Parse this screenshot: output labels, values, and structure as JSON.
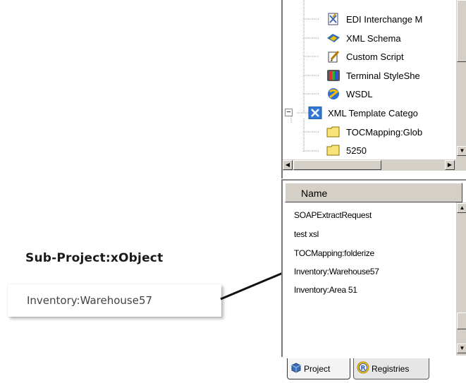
{
  "annotation": {
    "title": "Sub-Project:xObject",
    "callout": "Inventory:Warehouse57"
  },
  "tree": {
    "items": [
      {
        "label": "EDI Interchange M",
        "icon": "edi-interchange-icon"
      },
      {
        "label": "XML Schema",
        "icon": "xml-schema-icon"
      },
      {
        "label": "Custom Script",
        "icon": "custom-script-icon"
      },
      {
        "label": "Terminal StyleShe",
        "icon": "terminal-stylesheet-icon"
      },
      {
        "label": "WSDL",
        "icon": "wsdl-icon"
      },
      {
        "label": "XML Template Catego",
        "icon": "xml-template-category-icon"
      },
      {
        "label": "TOCMapping:Glob",
        "icon": "folder-icon"
      },
      {
        "label": "5250",
        "icon": "folder-icon"
      }
    ],
    "expander": "−"
  },
  "list": {
    "column_header": "Name",
    "items": [
      "SOAPExtractRequest",
      "test xsl",
      "TOCMapping:folderize",
      "Inventory:Warehouse57",
      "Inventory:Area 51"
    ]
  },
  "tabs": [
    {
      "label": "Project",
      "icon": "project-icon",
      "active": true
    },
    {
      "label": "Registries",
      "icon": "registries-icon",
      "active": false
    }
  ]
}
